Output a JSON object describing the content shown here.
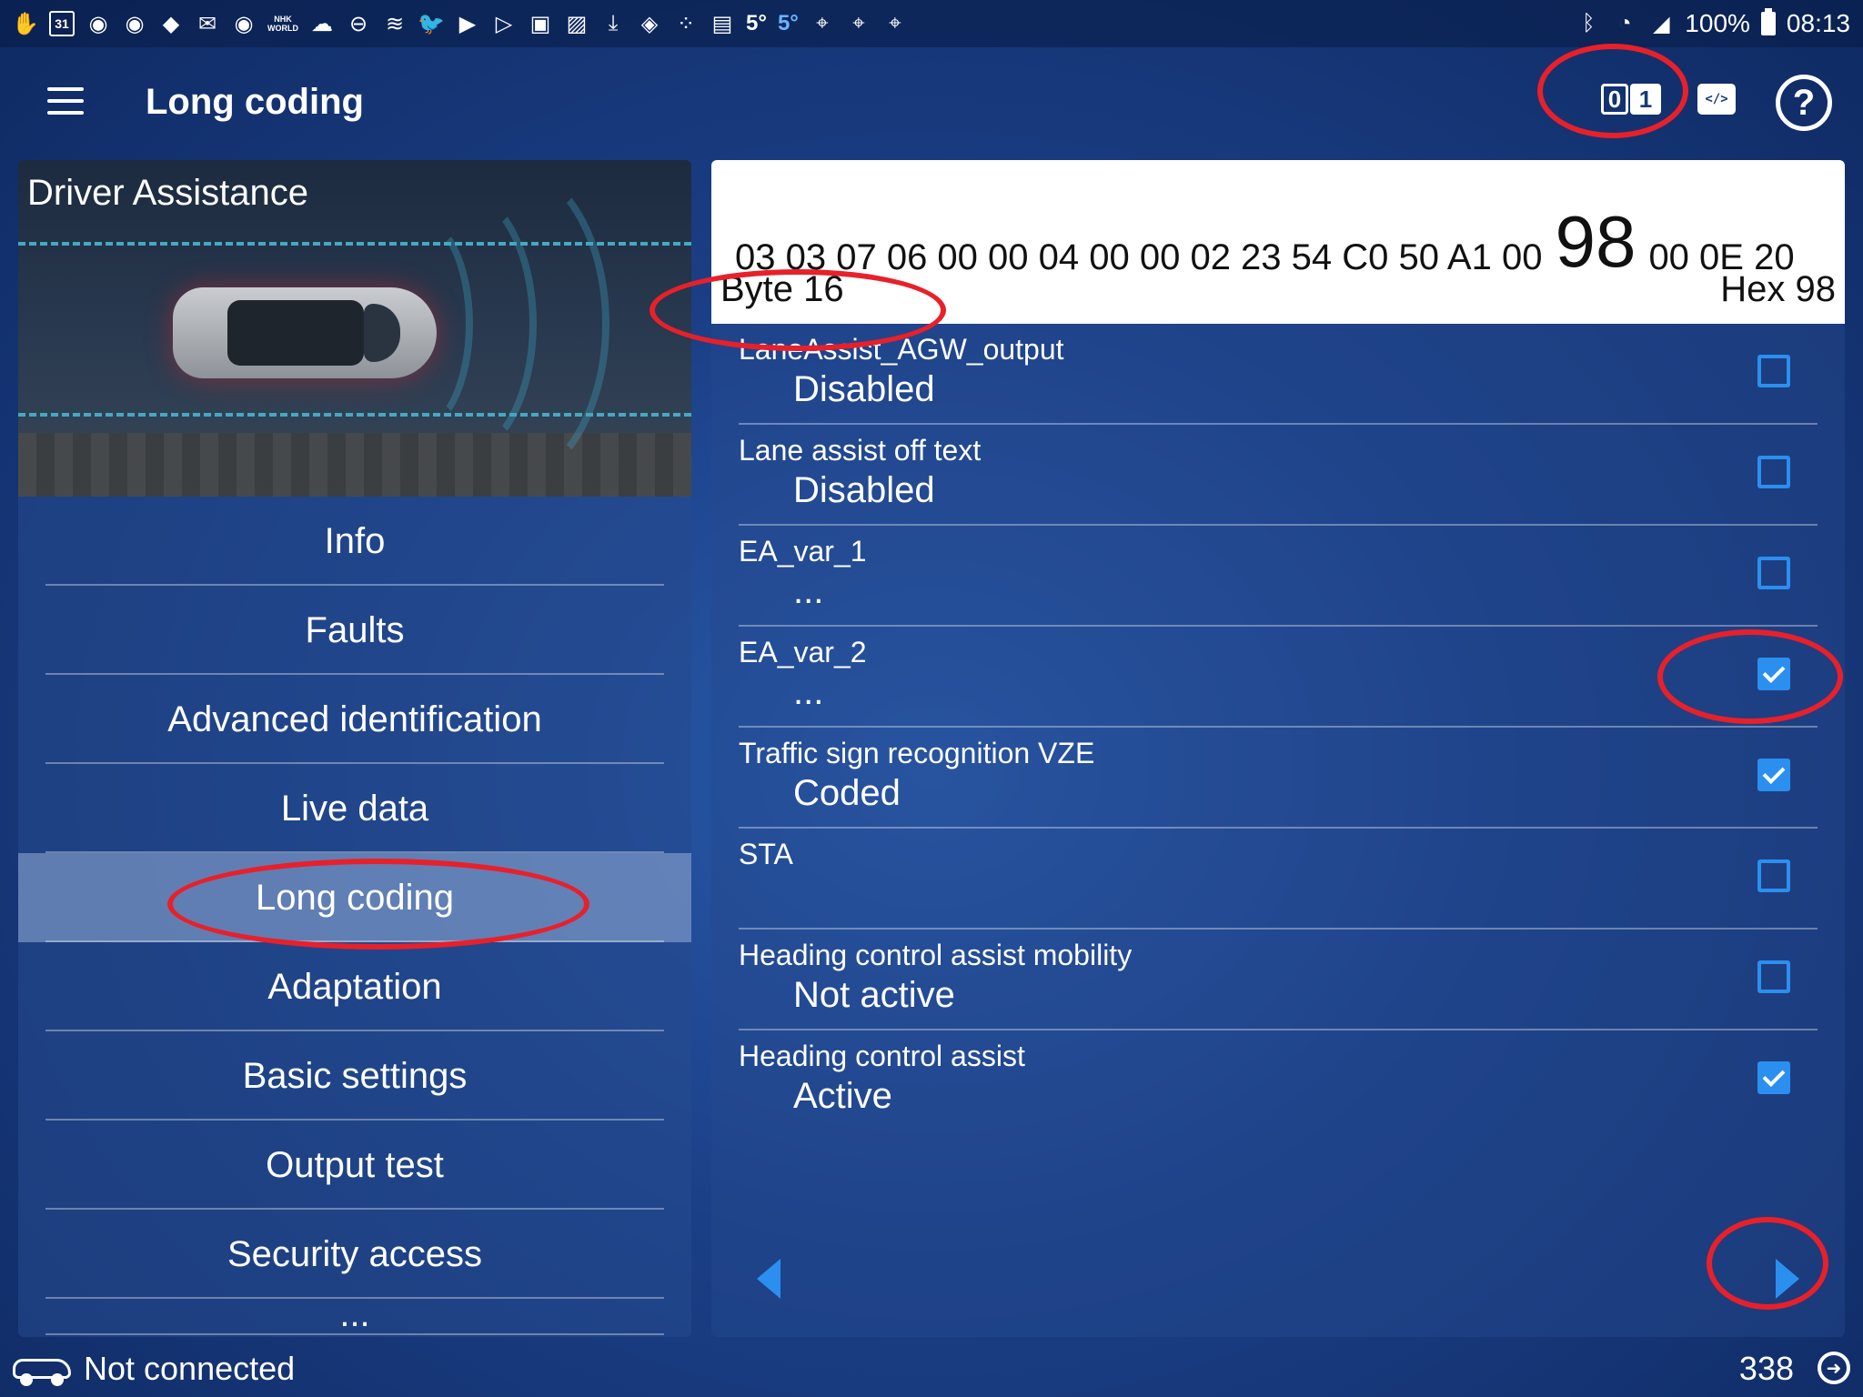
{
  "status_bar": {
    "left_icons": [
      "hand-icon",
      "calendar-icon",
      "g-icon",
      "g-icon",
      "diamond-icon",
      "mail-icon",
      "g-icon",
      "nhk-icon",
      "cloud-icon",
      "minus-circle-icon",
      "wind-icon",
      "twitter-icon",
      "youtube-icon",
      "play-icon",
      "flipboard-icon",
      "image-icon",
      "download-icon",
      "bag-icon",
      "dots-icon",
      "sim-icon"
    ],
    "calendar_day": "31",
    "nhk_label": "NHK WORLD",
    "temp_1": "5°",
    "temp_2": "5°",
    "battery": "100%",
    "time": "08:13"
  },
  "app_bar": {
    "title": "Long coding",
    "bits_0": "0",
    "bits_1": "1",
    "code_label": "</>",
    "help_label": "?"
  },
  "module": {
    "title": "Driver Assistance"
  },
  "nav": [
    {
      "label": "Info"
    },
    {
      "label": "Faults"
    },
    {
      "label": "Advanced identification"
    },
    {
      "label": "Live data"
    },
    {
      "label": "Long coding",
      "active": true
    },
    {
      "label": "Adaptation"
    },
    {
      "label": "Basic settings"
    },
    {
      "label": "Output test"
    },
    {
      "label": "Security access"
    },
    {
      "label": "..."
    }
  ],
  "hex": {
    "before": "03 03 07 06 00 00 04 00 00 02 23 54 C0 50 A1 00",
    "selected": "98",
    "after": "00 0E 20",
    "byte_label": "Byte 16",
    "hex_label": "Hex 98"
  },
  "settings": [
    {
      "name": "LaneAssist_AGW_output",
      "value": "Disabled",
      "checked": false
    },
    {
      "name": "Lane assist off text",
      "value": "Disabled",
      "checked": false
    },
    {
      "name": "EA_var_1",
      "value": "...",
      "checked": false
    },
    {
      "name": "EA_var_2",
      "value": "...",
      "checked": true
    },
    {
      "name": "Traffic sign recognition VZE",
      "value": "Coded",
      "checked": true
    },
    {
      "name": "STA",
      "value": "",
      "checked": false
    },
    {
      "name": "Heading control assist mobility",
      "value": "Not active",
      "checked": false
    },
    {
      "name": "Heading control assist",
      "value": "Active",
      "checked": true
    }
  ],
  "footer": {
    "connection": "Not connected",
    "count": "338"
  },
  "colors": {
    "accent": "#2b8ff0",
    "annotation": "#e8202a",
    "background": "#1b3f86"
  }
}
